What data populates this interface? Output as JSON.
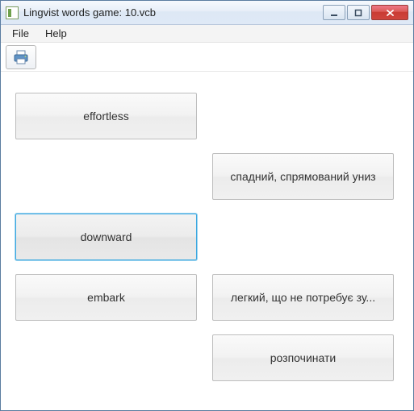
{
  "window": {
    "title": "Lingvist words game: 10.vcb"
  },
  "menu": {
    "file": "File",
    "help": "Help"
  },
  "cards": {
    "left": [
      {
        "label": "effortless",
        "selected": false
      },
      {
        "label": "downward",
        "selected": true
      },
      {
        "label": "embark",
        "selected": false
      }
    ],
    "right": [
      {
        "label": "спадний, спрямований униз"
      },
      {
        "label": "легкий, що не потребує зу..."
      },
      {
        "label": "розпочинати"
      }
    ]
  }
}
